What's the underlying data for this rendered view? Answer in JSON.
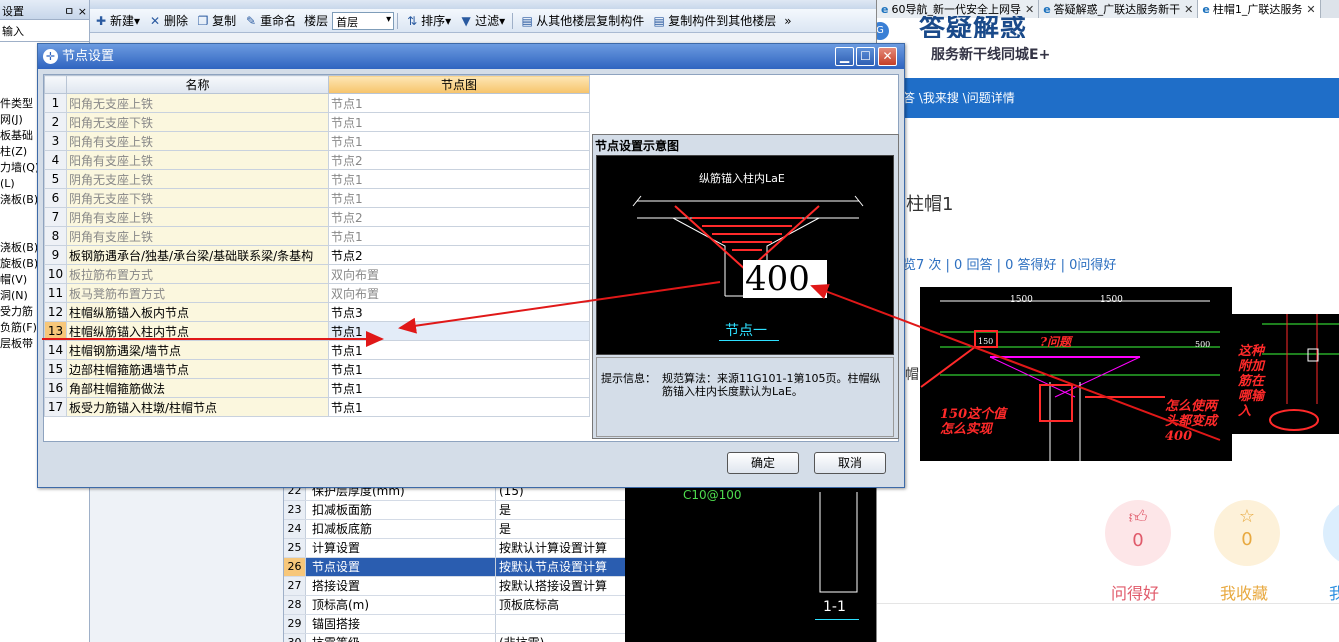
{
  "app": {
    "left_panel": {
      "header_label": "设置",
      "header_pin": "ㅁ ×",
      "input_tab": "输入",
      "tree_items": [
        "件类型",
        "网(J)",
        "板基础",
        "柱(Z)",
        "力墙(Q)",
        "(L)",
        "浇板(B)",
        "",
        "",
        "浇板(B)",
        "旋板(B)",
        "帽(V)",
        "洞(N)",
        "受力筋",
        "负筋(F)",
        "层板带"
      ]
    },
    "toolbar": {
      "new_label": "新建",
      "delete_label": "删除",
      "copy_label": "复制",
      "rename_label": "重命名",
      "floor_label": "楼层",
      "floor_value": "首层",
      "sort_label": "排序",
      "filter_label": "过滤",
      "copy_from_floor_label": "从其他楼层复制构件",
      "copy_to_floor_label": "复制构件到其他楼层",
      "more": "»"
    },
    "prop_rows": [
      {
        "num": "22",
        "name": "保护层厚度(mm)",
        "value": "(15)"
      },
      {
        "num": "23",
        "name": "扣减板面筋",
        "value": "是"
      },
      {
        "num": "24",
        "name": "扣减板底筋",
        "value": "是"
      },
      {
        "num": "25",
        "name": "计算设置",
        "value": "按默认计算设置计算"
      },
      {
        "num": "26",
        "name": "节点设置",
        "value": "按默认节点设置计算"
      },
      {
        "num": "27",
        "name": "搭接设置",
        "value": "按默认搭接设置计算"
      },
      {
        "num": "28",
        "name": "顶标高(m)",
        "value": "顶板底标高"
      },
      {
        "num": "29",
        "name": "锚固搭接",
        "value": ""
      },
      {
        "num": "30",
        "name": "抗震等级",
        "value": "(非抗震)"
      }
    ],
    "cad_bg": {
      "label1": "C10@100",
      "label2": "1-1"
    }
  },
  "dialog": {
    "title": "节点设置",
    "col_name": "名称",
    "col_node": "节点图",
    "rows": [
      {
        "num": "1",
        "name": "阳角无支座上铁",
        "value": "节点1",
        "grey": true
      },
      {
        "num": "2",
        "name": "阳角无支座下铁",
        "value": "节点1",
        "grey": true
      },
      {
        "num": "3",
        "name": "阳角有支座上铁",
        "value": "节点1",
        "grey": true
      },
      {
        "num": "4",
        "name": "阳角有支座上铁",
        "value": "节点2",
        "grey": true
      },
      {
        "num": "5",
        "name": "阴角无支座上铁",
        "value": "节点1",
        "grey": true
      },
      {
        "num": "6",
        "name": "阴角无支座下铁",
        "value": "节点1",
        "grey": true
      },
      {
        "num": "7",
        "name": "阴角有支座上铁",
        "value": "节点2",
        "grey": true
      },
      {
        "num": "8",
        "name": "阴角有支座上铁",
        "value": "节点1",
        "grey": true
      },
      {
        "num": "9",
        "name": "板钢筋遇承台/独基/承台梁/基础联系梁/条基构",
        "value": "节点2",
        "grey": false
      },
      {
        "num": "10",
        "name": "板拉筋布置方式",
        "value": "双向布置",
        "grey": true
      },
      {
        "num": "11",
        "name": "板马凳筋布置方式",
        "value": "双向布置",
        "grey": true
      },
      {
        "num": "12",
        "name": "柱帽纵筋锚入板内节点",
        "value": "节点3",
        "grey": false
      },
      {
        "num": "13",
        "name": "柱帽纵筋锚入柱内节点",
        "value": "节点1",
        "grey": false
      },
      {
        "num": "14",
        "name": "柱帽钢筋遇梁/墙节点",
        "value": "节点1",
        "grey": false
      },
      {
        "num": "15",
        "name": "边部柱帽箍筋遇墙节点",
        "value": "节点1",
        "grey": false
      },
      {
        "num": "16",
        "name": "角部柱帽箍筋做法",
        "value": "节点1",
        "grey": false
      },
      {
        "num": "17",
        "name": "板受力筋锚入柱墩/柱帽节点",
        "value": "节点1",
        "grey": false
      }
    ],
    "preview": {
      "title": "节点设置示意图",
      "canvas_title": "纵筋锚入柱内LaE",
      "value": "400",
      "node_label": "节点一",
      "info_label": "提示信息：",
      "info_text": "规范算法：来源11G101-1第105页。柱帽纵筋锚入柱内长度默认为LaE。"
    },
    "ok_label": "确定",
    "cancel_label": "取消"
  },
  "browser": {
    "tabs": [
      {
        "label": "60导航_新一代安全上网导",
        "active": false
      },
      {
        "label": "答疑解惑_广联达服务新干",
        "active": false
      },
      {
        "label": "柱帽1_广联达服务",
        "active": true
      }
    ],
    "logo": "答疑解惑",
    "subtitle": "服务新干线同城E+",
    "nav": "答 \\我来搜 \\问题详情",
    "question_title": "柱帽1",
    "stats": "览7 次 | 0 回答 | 0 答得好 | 0问得好",
    "side_label": "帽",
    "actions": [
      {
        "label": "问得好",
        "count": "0"
      },
      {
        "label": "我收藏",
        "count": "0"
      },
      {
        "label": "我",
        "count": ""
      }
    ]
  },
  "annotations": {
    "note1": "150这个值怎么实现",
    "note2": "怎么使两头都变成400",
    "note3": "这种附加筋在哪输入",
    "note4": "?问题",
    "dim1": "1500",
    "dim2": "1500",
    "dim3": "150",
    "dim4": "500"
  },
  "colors": {
    "accent": "#2f64c0",
    "annotation": "#ff2a2a",
    "cad_bg": "#000000",
    "nav": "#1f6ec8"
  }
}
